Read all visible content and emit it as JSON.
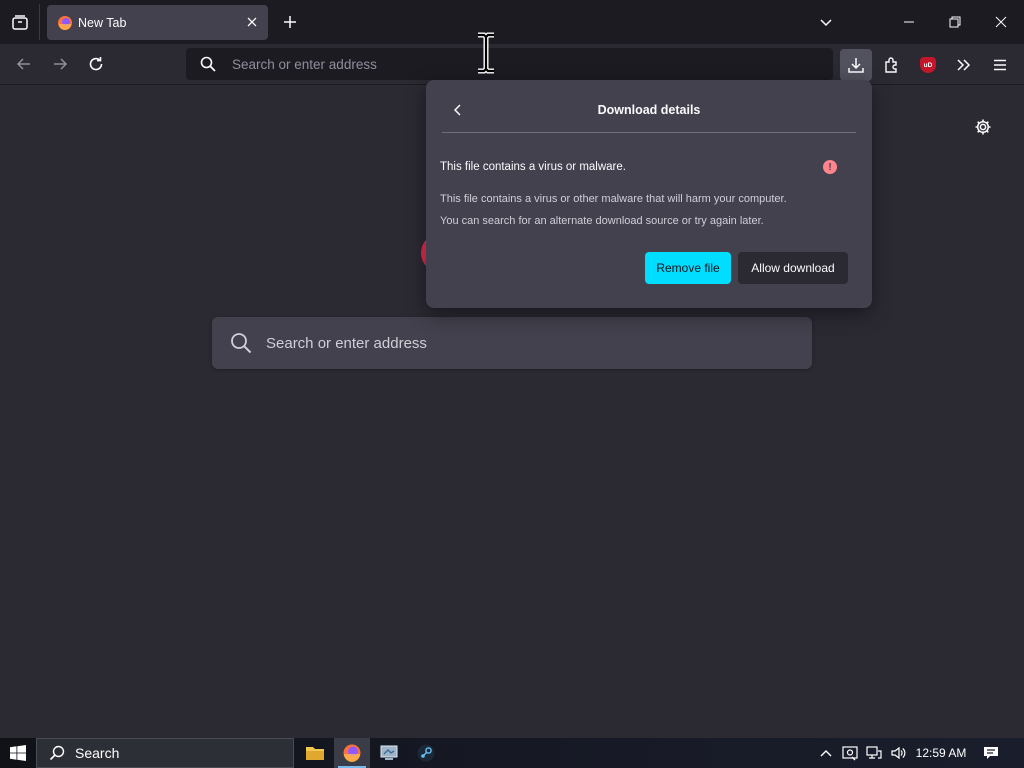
{
  "browser": {
    "tab": {
      "title": "New Tab"
    },
    "urlbar": {
      "placeholder": "Search or enter address"
    }
  },
  "newtab": {
    "search": {
      "placeholder": "Search or enter address"
    }
  },
  "download_panel": {
    "title": "Download details",
    "heading": "This file contains a virus or malware.",
    "warning_glyph": "!",
    "description_line1": "This file contains a virus or other malware that will harm your computer.",
    "description_line2": "You can search for an alternate download source or try again later.",
    "remove_label": "Remove file",
    "allow_label": "Allow download"
  },
  "toolbar": {
    "ublock_badge": "uD"
  },
  "taskbar": {
    "search_label": "Search",
    "clock": "12:59 AM"
  },
  "icons": [
    "tab-list-icon",
    "firefox-favicon",
    "close-icon",
    "plus-icon",
    "chevron-down-icon",
    "minimize-icon",
    "restore-icon",
    "window-close-icon",
    "back-icon",
    "forward-icon",
    "reload-icon",
    "search-icon",
    "download-icon",
    "extensions-icon",
    "ublock-icon",
    "overflow-icon",
    "menu-icon",
    "gear-icon",
    "warning-icon",
    "windows-icon",
    "file-explorer-icon",
    "firefox-icon",
    "app-icon",
    "steam-icon",
    "chevron-up-icon",
    "network-icon",
    "volume-icon",
    "notification-icon"
  ],
  "colors": {
    "accent": "#00ddff",
    "warning": "#ff848b",
    "panel_bg": "#42414d",
    "content_bg": "#2b2a33",
    "chrome_bg": "#1c1b22"
  }
}
